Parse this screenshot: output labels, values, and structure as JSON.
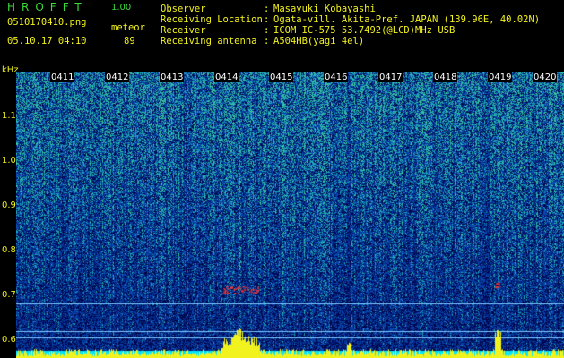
{
  "header": {
    "app_title": "HROFFT",
    "version": "1.00",
    "filename": "0510170410.png",
    "mode": "meteor",
    "datetime": "05.10.17 04:10",
    "count": "89",
    "fields": [
      {
        "label": "Observer",
        "value": "Masayuki Kobayashi"
      },
      {
        "label": "Receiving Location",
        "value": "Ogata-vill. Akita-Pref. JAPAN (139.96E, 40.02N)"
      },
      {
        "label": "Receiver",
        "value": "ICOM IC-575 53.7492(@LCD)MHz USB"
      },
      {
        "label": "Receiving antenna",
        "value": "A504HB(yagi 4el)"
      }
    ]
  },
  "spectrogram": {
    "y_unit": "kHz",
    "y_ticks": [
      "1.1",
      "1.0",
      "0.9",
      "0.8",
      "0.7",
      "0.6"
    ],
    "x_ticks": [
      "0411",
      "0412",
      "0413",
      "0414",
      "0415",
      "0416",
      "0417",
      "0418",
      "0419",
      "0420"
    ],
    "colors": {
      "background": "#000000",
      "label": "#f2f21e",
      "baseline": "#00e5ff",
      "guide": "#7ec8ff",
      "detection": "#ff3030"
    }
  }
}
